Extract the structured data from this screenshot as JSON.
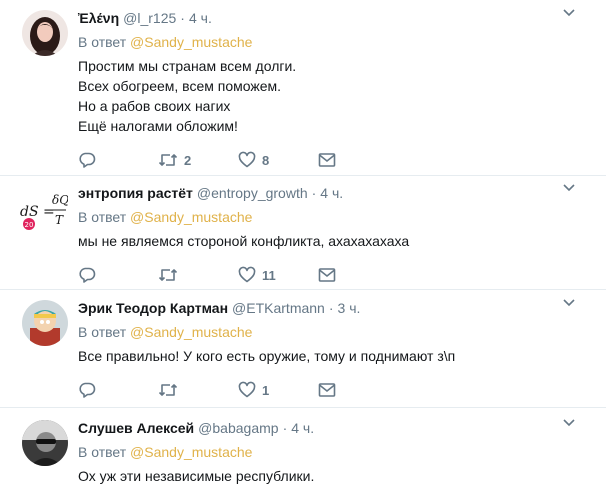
{
  "tweets": [
    {
      "name": "Ἐλένη",
      "handle": "@l_r125",
      "time": "4 ч.",
      "reply_prefix": "В ответ",
      "reply_to": "@Sandy_mustache",
      "lines": [
        "Простим мы странам всем долги.",
        "Всех обогреем, всем поможем.",
        "Но а рабов своих нагих",
        "Ещё налогами обложим!"
      ],
      "retweets": "2",
      "likes": "8"
    },
    {
      "name": "энтропия растёт",
      "handle": "@entropy_growth",
      "time": "4 ч.",
      "reply_prefix": "В ответ",
      "reply_to": "@Sandy_mustache",
      "lines": [
        "мы не являемся стороной конфликта, ахахахахаха"
      ],
      "retweets": "",
      "likes": "11",
      "avatar_text": {
        "numerator": "δQ",
        "left": "dS =",
        "denominator": "T",
        "badge": "20"
      }
    },
    {
      "name": "Эрик Теодор Картман",
      "handle": "@ETKartmann",
      "time": "3 ч.",
      "reply_prefix": "В ответ",
      "reply_to": "@Sandy_mustache",
      "lines": [
        "Все правильно! У кого есть оружие, тому и поднимают з\\п"
      ],
      "retweets": "",
      "likes": "1"
    },
    {
      "name": "Слушев Алексей",
      "handle": "@babagamp",
      "time": "4 ч.",
      "reply_prefix": "В ответ",
      "reply_to": "@Sandy_mustache",
      "lines": [
        "Ох уж эти независимые республики."
      ],
      "retweets": "",
      "likes": ""
    }
  ],
  "colors": {
    "mention": "#e0b24a",
    "muted": "#657786",
    "text": "#14171a",
    "divider": "#e6ecf0"
  },
  "icons": {
    "reply": "reply-icon",
    "retweet": "retweet-icon",
    "like": "heart-icon",
    "dm": "envelope-icon",
    "more": "chevron-down-icon"
  }
}
